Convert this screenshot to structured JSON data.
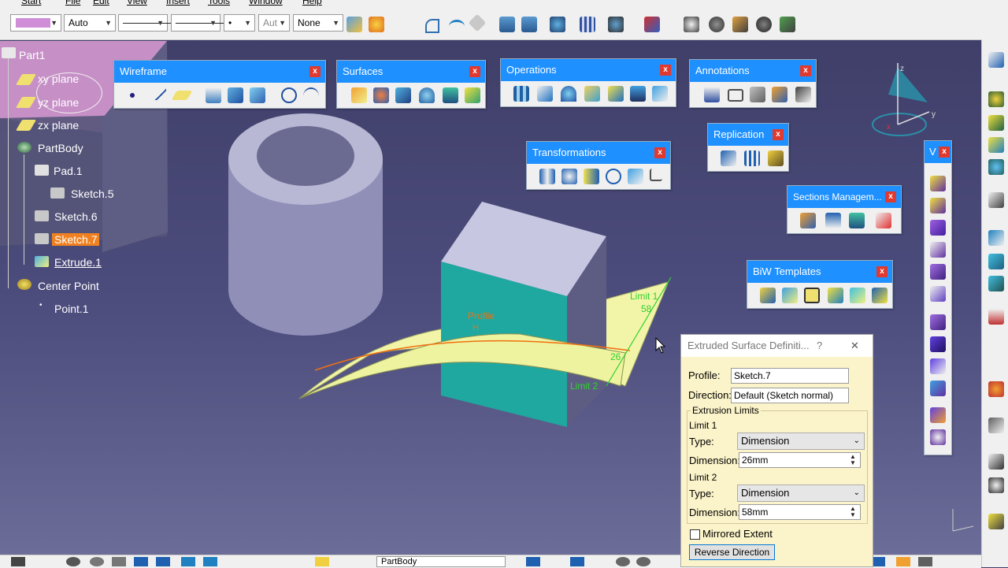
{
  "menu": {
    "items": [
      "Start",
      "File",
      "Edit",
      "View",
      "Insert",
      "Tools",
      "Window",
      "Help"
    ]
  },
  "toolbar_top": {
    "color_combo": "",
    "auto_combo": "Auto",
    "line_combo_1": "────────",
    "line_combo_2": "────────",
    "point_combo": "•",
    "aut_combo": "Aut",
    "none_combo": "None"
  },
  "tree": {
    "items": [
      {
        "label": "Part1"
      },
      {
        "label": "xy plane"
      },
      {
        "label": "yz plane"
      },
      {
        "label": "zx plane"
      },
      {
        "label": "PartBody"
      },
      {
        "label": "Pad.1"
      },
      {
        "label": "Sketch.5"
      },
      {
        "label": "Sketch.6"
      },
      {
        "label": "Sketch.7"
      },
      {
        "label": "Extrude.1"
      },
      {
        "label": "Center Point"
      },
      {
        "label": "Point.1"
      }
    ]
  },
  "toolbars": {
    "wireframe": {
      "title": "Wireframe",
      "close": "x"
    },
    "surfaces": {
      "title": "Surfaces",
      "close": "x"
    },
    "operations": {
      "title": "Operations",
      "close": "x"
    },
    "annotations": {
      "title": "Annotations",
      "close": "x"
    },
    "transformations": {
      "title": "Transformations",
      "close": "x"
    },
    "replication": {
      "title": "Replication",
      "close": "x"
    },
    "sections": {
      "title": "Sections Managem...",
      "close": "x"
    },
    "biw": {
      "title": "BiW Templates",
      "close": "x"
    },
    "v": {
      "title": "V",
      "close": "x"
    }
  },
  "viewport": {
    "profile_label": "Profile",
    "h_label": "H",
    "limit1_label": "Limit 1",
    "limit1_value": "58",
    "limit2_label": "Limit 2",
    "limit2_value": "26",
    "axis_z": "z",
    "axis_y": "y",
    "axis_x": "x"
  },
  "dialog": {
    "title": "Extruded Surface Definiti...",
    "help": "?",
    "close": "✕",
    "profile_label": "Profile:",
    "profile_value": "Sketch.7",
    "direction_label": "Direction:",
    "direction_value": "Default (Sketch normal)",
    "extrusion_limits": "Extrusion Limits",
    "limit1": "Limit 1",
    "type_label_1": "Type:",
    "type_value_1": "Dimension",
    "dimension_label_1": "Dimension:",
    "dimension_value_1": "26mm",
    "limit2": "Limit 2",
    "type_label_2": "Type:",
    "type_value_2": "Dimension",
    "dimension_label_2": "Dimension:",
    "dimension_value_2": "58mm",
    "mirrored_extent": "Mirrored Extent",
    "reverse_direction": "Reverse Direction"
  },
  "bottom": {
    "combo_value": "PartBody"
  },
  "colors": {
    "accent": "#1e90ff",
    "highlight": "#f08020",
    "background": "#45457a",
    "dialog_bg": "#fbf3c9"
  }
}
